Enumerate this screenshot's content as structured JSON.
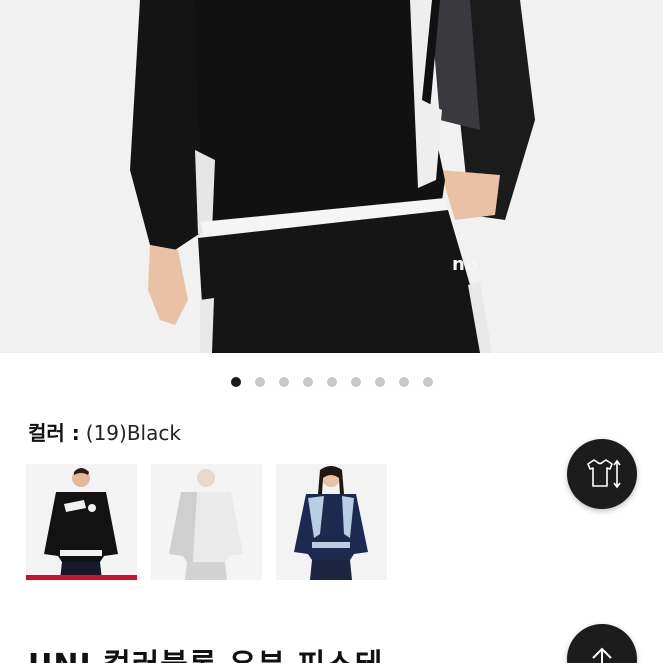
{
  "hero": {
    "image": "product-model-photo"
  },
  "carousel": {
    "count": 9,
    "active_index": 0
  },
  "color": {
    "label": "컬러 :",
    "value": "(19)Black"
  },
  "swatches": [
    {
      "name": "black",
      "selected": true
    },
    {
      "name": "white",
      "selected": false
    },
    {
      "name": "navy",
      "selected": false
    }
  ],
  "product": {
    "title": "UNI 컬러블록 우븐 피스테"
  },
  "icons": {
    "size_guide": "tshirt-size-icon",
    "scroll_top": "arrow-up-icon"
  },
  "colors": {
    "accent": "#d0112b",
    "fab": "#1c1c1c",
    "dot_active": "#1a1a1a",
    "dot_inactive": "#c8c8c8"
  }
}
